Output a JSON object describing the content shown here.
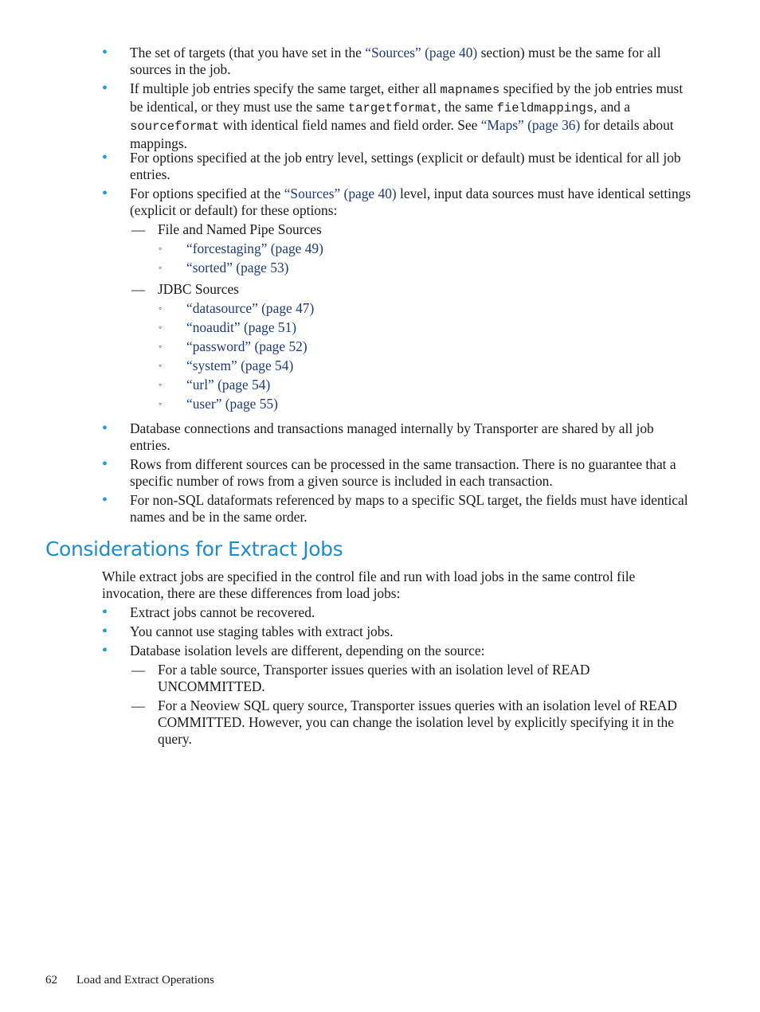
{
  "load_section": {
    "items": [
      {
        "t1": "The set of targets (that you have set in the ",
        "link": "“Sources” (page 40)",
        "t2": " section) must be the same for all sources in the job."
      },
      {
        "t1": "If multiple job entries specify the same target, either all ",
        "c1": "mapnames",
        "t2": " specified by the job entries must be identical, or they must use the same ",
        "c2": "targetformat",
        "t3": ", the same ",
        "c3": "fieldmappings",
        "t4": ", and a ",
        "c4": "sourceformat",
        "t5": " with identical field names and field order. See ",
        "link": "“Maps” (page 36)",
        "t6": " for details about mappings."
      },
      {
        "text": "For options specified at the job entry level, settings (explicit or default) must be identical for all job entries."
      },
      {
        "t1": "For options specified at the ",
        "link": "“Sources” (page 40)",
        "t2": " level, input data sources must have identical settings (explicit or default) for these options:",
        "groups": [
          {
            "label": "File and Named Pipe Sources",
            "links": [
              "“forcestaging” (page 49)",
              "“sorted” (page 53)"
            ]
          },
          {
            "label": "JDBC Sources",
            "links": [
              "“datasource” (page 47)",
              "“noaudit” (page 51)",
              "“password” (page 52)",
              "“system” (page 54)",
              "“url” (page 54)",
              "“user” (page 55)"
            ]
          }
        ]
      },
      {
        "text": "Database connections and transactions managed internally by Transporter are shared by all job entries."
      },
      {
        "text": "Rows from different sources can be processed in the same transaction. There is no guarantee that a specific number of rows from a given source is included in each transaction."
      },
      {
        "text": "For non-SQL dataformats referenced by maps to a specific SQL target, the fields must have identical names and be in the same order."
      }
    ]
  },
  "extract_section": {
    "heading": "Considerations for Extract Jobs",
    "intro": "While extract jobs are specified in the control file and run with load jobs in the same control file invocation, there are these differences from load jobs:",
    "items": [
      {
        "text": "Extract jobs cannot be recovered."
      },
      {
        "text": "You cannot use staging tables with extract jobs."
      },
      {
        "text": "Database isolation levels are different, depending on the source:",
        "subitems": [
          "For a table source, Transporter issues queries with an isolation level of READ UNCOMMITTED.",
          "For a Neoview SQL query source, Transporter issues queries with an isolation level of READ COMMITTED. However, you can change the isolation level by explicitly specifying it in the query."
        ]
      }
    ]
  },
  "footer": {
    "page_number": "62",
    "chapter": "Load and Extract Operations"
  },
  "icons": {
    "bullet": "•",
    "dash": "—",
    "circle": "◦"
  },
  "colors": {
    "heading": "#1e8ccc",
    "bullet": "#1e9ad6",
    "link": "#1f3b73",
    "text": "#1a1a1a"
  }
}
